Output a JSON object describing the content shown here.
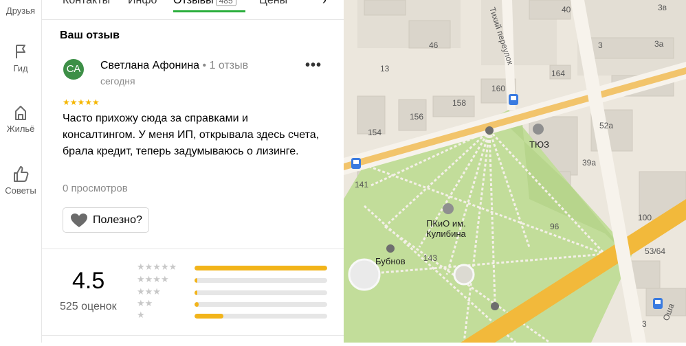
{
  "rail": {
    "items": [
      {
        "label": "Друзья"
      },
      {
        "label": "Гид"
      },
      {
        "label": "Жильё"
      },
      {
        "label": "Советы"
      }
    ]
  },
  "tabs": [
    {
      "label": "Контакты"
    },
    {
      "label": "Инфо"
    },
    {
      "label": "Отзывы",
      "count": "485",
      "active": true
    },
    {
      "label": "Цены"
    }
  ],
  "review_section": {
    "title": "Ваш отзыв",
    "author": {
      "initials": "СА",
      "name": "Светлана Афонина",
      "reviews_count": "1 отзыв",
      "avatar_color": "#3d8f47"
    },
    "date": "сегодня",
    "stars": 5,
    "text": "Часто прихожу сюда за справками и консалтингом. У меня ИП, открывала здесь счета, брала кредит, теперь задумываюсь о лизинге.",
    "views": "0 просмотров",
    "helpful_label": "Полезно?"
  },
  "rating": {
    "value": "4.5",
    "count_text": "525 оценок",
    "distribution": [
      {
        "stars": 5,
        "fraction": 1.0
      },
      {
        "stars": 4,
        "fraction": 0.02
      },
      {
        "stars": 3,
        "fraction": 0.02
      },
      {
        "stars": 2,
        "fraction": 0.03
      },
      {
        "stars": 1,
        "fraction": 0.22
      }
    ],
    "bar_color": "#f2b41a"
  },
  "map": {
    "labels": {
      "street_tikhiy": "Тихий переулок",
      "tyuz": "ТЮЗ",
      "park": "ПКиО им.",
      "park2": "Кулибина",
      "bubnov": "Бубнов",
      "osh": "Оша"
    },
    "house_numbers": [
      "40",
      "3в",
      "46",
      "3",
      "3а",
      "13",
      "164",
      "160",
      "158",
      "156",
      "154",
      "52а",
      "39а",
      "141",
      "96",
      "100",
      "143",
      "53/64",
      "3"
    ],
    "colors": {
      "park": "#c2dd9a",
      "road_orange": "#f2b93b",
      "background": "#ece7dd"
    }
  }
}
